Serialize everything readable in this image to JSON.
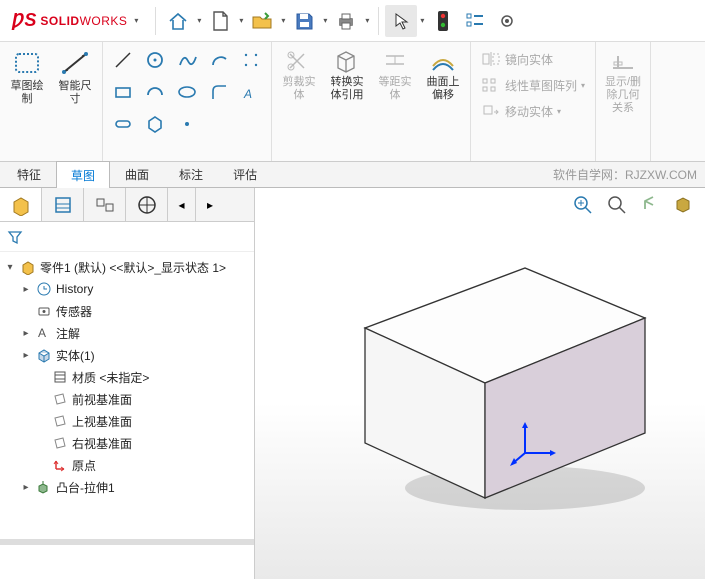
{
  "app": {
    "brand_strong": "SOLID",
    "brand_light": "WORKS"
  },
  "titlebar_icons": [
    "home",
    "new",
    "open",
    "save",
    "print",
    "select",
    "traffic",
    "list",
    "settings"
  ],
  "ribbon": {
    "sketch_create": "草图绘\n制",
    "smart_dim": "智能尺\n寸",
    "trim": "剪裁实\n体",
    "convert": "转换实\n体引用",
    "offset_entities": "等距实\n体",
    "offset_surface": "曲面上\n偏移",
    "mirror": "镜向实体",
    "linear_pattern": "线性草图阵列",
    "move": "移动实体",
    "display_relations": "显示/删\n除几何\n关系"
  },
  "tabs": {
    "items": [
      "特征",
      "草图",
      "曲面",
      "标注",
      "评估"
    ],
    "active_index": 1,
    "watermark": "软件自学网：RJZXW.COM"
  },
  "tree": {
    "root": "零件1 (默认) <<默认>_显示状态 1>",
    "items": [
      {
        "label": "History",
        "icon": "history",
        "exp": "▸"
      },
      {
        "label": "传感器",
        "icon": "sensor",
        "exp": ""
      },
      {
        "label": "注解",
        "icon": "annotation",
        "exp": "▸"
      },
      {
        "label": "实体(1)",
        "icon": "solidbody",
        "exp": "▸"
      },
      {
        "label": "材质 <未指定>",
        "icon": "material",
        "exp": ""
      },
      {
        "label": "前视基准面",
        "icon": "plane",
        "exp": ""
      },
      {
        "label": "上视基准面",
        "icon": "plane",
        "exp": ""
      },
      {
        "label": "右视基准面",
        "icon": "plane",
        "exp": ""
      },
      {
        "label": "原点",
        "icon": "origin",
        "exp": ""
      },
      {
        "label": "凸台-拉伸1",
        "icon": "extrude",
        "exp": "▸"
      }
    ]
  }
}
